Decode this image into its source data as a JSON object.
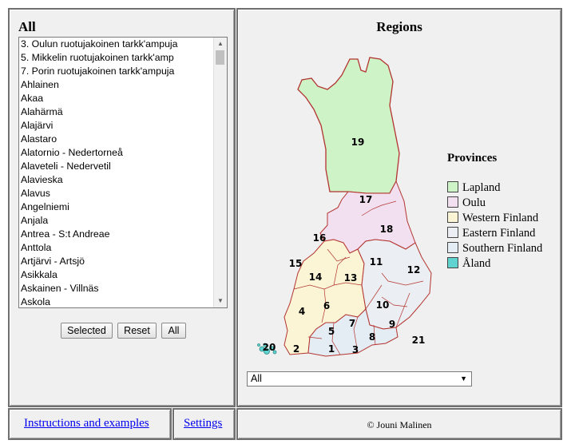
{
  "list_panel": {
    "title": "All",
    "items": [
      "3. Oulun ruotujakoinen tarkk'ampuja",
      "5. Mikkelin ruotujakoinen tarkk'amp",
      "7. Porin ruotujakoinen tarkk'ampuja",
      "Ahlainen",
      "Akaa",
      "Alahärmä",
      "Alajärvi",
      "Alastaro",
      "Alatornio - Nedertorneå",
      "Alaveteli - Nedervetil",
      "Alavieska",
      "Alavus",
      "Angelniemi",
      "Anjala",
      "Antrea - S:t Andreae",
      "Anttola",
      "Artjärvi - Artsjö",
      "Asikkala",
      "Askainen - Villnäs",
      "Askola"
    ],
    "buttons": {
      "selected": "Selected",
      "reset": "Reset",
      "all": "All"
    }
  },
  "regions_panel": {
    "title": "Regions",
    "region_numbers": [
      "19",
      "17",
      "18",
      "16",
      "15",
      "11",
      "12",
      "14",
      "13",
      "4",
      "6",
      "10",
      "7",
      "9",
      "5",
      "8",
      "20",
      "2",
      "1",
      "3",
      "21"
    ],
    "provinces_title": "Provinces",
    "provinces": [
      {
        "name": "Lapland",
        "color": "#cdf3c7"
      },
      {
        "name": "Oulu",
        "color": "#f2dff0"
      },
      {
        "name": "Western Finland",
        "color": "#fbf5d6"
      },
      {
        "name": "Eastern Finland",
        "color": "#ebeef2"
      },
      {
        "name": "Southern Finland",
        "color": "#e4ecf4"
      },
      {
        "name": "Åland",
        "color": "#5fd3cf"
      }
    ],
    "select_value": "All"
  },
  "footer": {
    "instructions_link": "Instructions and examples",
    "settings_link": "Settings",
    "copyright": "© Jouni Malinen"
  },
  "colors": {
    "border_red": "#b3332e",
    "panel_bg": "#f0f0f0",
    "link": "#0000ee"
  }
}
